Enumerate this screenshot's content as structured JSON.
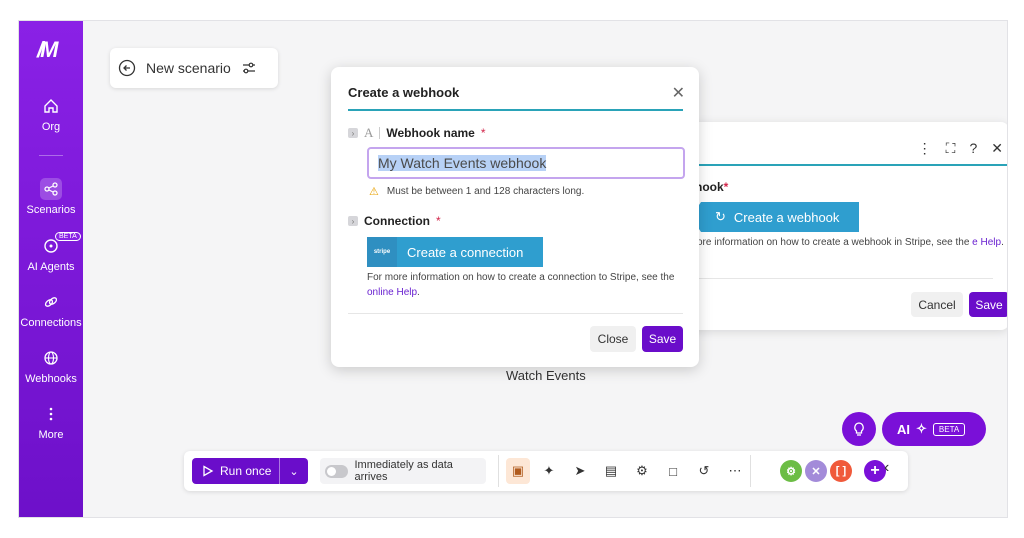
{
  "sidebar": {
    "logo": "/M",
    "items": [
      {
        "label": "Org",
        "icon": "home-icon"
      },
      {
        "label": "Scenarios",
        "icon": "share-icon"
      },
      {
        "label": "AI Agents",
        "icon": "ai-agent-icon",
        "badge": "BETA"
      },
      {
        "label": "Connections",
        "icon": "link-icon"
      },
      {
        "label": "Webhooks",
        "icon": "globe-icon"
      },
      {
        "label": "More",
        "icon": "more-vertical-icon"
      }
    ]
  },
  "scenario": {
    "title": "New scenario"
  },
  "canvas": {
    "module_label": "Watch Events"
  },
  "bg_panel": {
    "field_label": "hook",
    "create_webhook_label": "Create a webhook",
    "hint_text": "ore information on how to create a webhook in Stripe, see the",
    "hint_link": "e Help",
    "cancel_label": "Cancel",
    "save_label": "Save"
  },
  "modal": {
    "title": "Create a webhook",
    "webhook_name_label": "Webhook name",
    "webhook_name_value": "My Watch Events webhook",
    "warning": "Must be between 1 and 128 characters long.",
    "connection_label": "Connection",
    "stripe_logo": "stripe",
    "create_connection_label": "Create a connection",
    "conn_hint": "For more information on how to create a connection to Stripe, see the",
    "conn_hint_link": "online Help",
    "close_label": "Close",
    "save_label": "Save"
  },
  "toolbar": {
    "run_once_label": "Run once",
    "schedule_label": "Immediately as data arrives",
    "icons": [
      "scheduling-icon",
      "magic-wand-icon",
      "flow-icon",
      "data-store-icon",
      "settings-icon",
      "notes-icon",
      "undo-icon",
      "more-icon"
    ],
    "app_colors": [
      "#6cbd45",
      "#a38bd9",
      "#f05a3b",
      "#7a10d8"
    ]
  },
  "ai": {
    "label": "AI",
    "badge": "BETA"
  },
  "colors": {
    "brand": "#6a0dca",
    "accent": "#2aa3b8",
    "button_blue": "#2f9ecf"
  }
}
